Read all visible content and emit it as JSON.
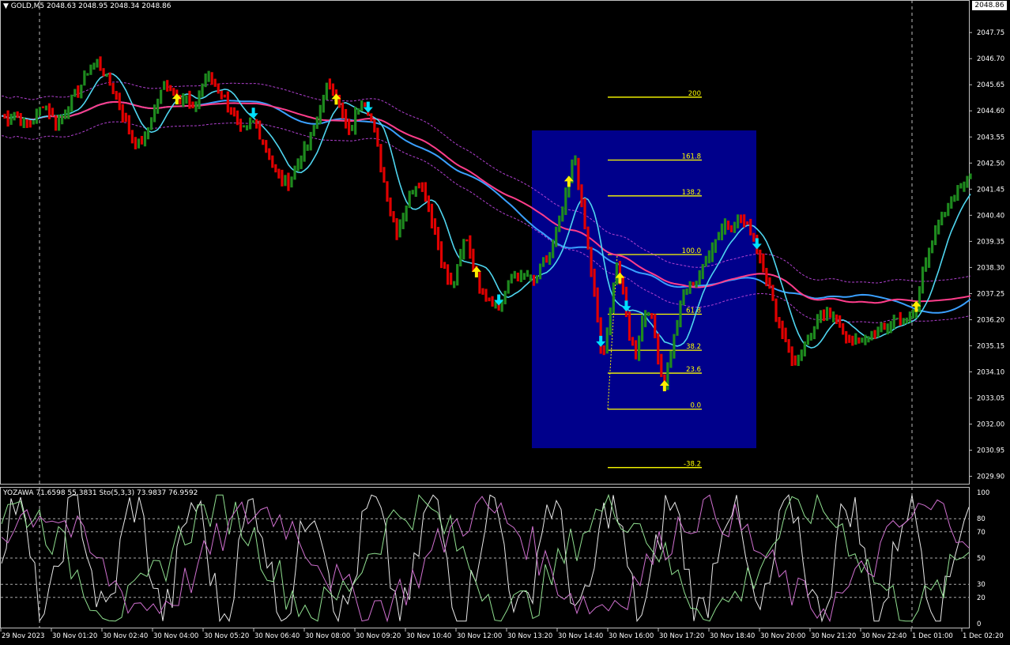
{
  "symbol_header": {
    "symbol": "GOLD,M5",
    "ohlc": "2048.63 2048.95 2048.34 2048.86",
    "current_price": "2048.86"
  },
  "colors": {
    "background": "#000000",
    "bull": "#1e8a1e",
    "bear": "#e00000",
    "fast_ma": "#4fd6f0",
    "slow_ma": "#3aa0ff",
    "long_ma": "#ff3d8b",
    "envelope": "#b040d0",
    "fib_line": "#ffff00",
    "fib_box": "#00008b",
    "up_arrow": "#ffee00",
    "down_arrow": "#00e0ff"
  },
  "price_axis": {
    "ticks": [
      "2047.75",
      "2046.70",
      "2045.65",
      "2044.60",
      "2043.55",
      "2042.50",
      "2041.45",
      "2040.40",
      "2039.35",
      "2038.30",
      "2037.25",
      "2036.20",
      "2035.15",
      "2034.10",
      "2033.05",
      "2032.00",
      "2030.95",
      "2029.90"
    ]
  },
  "fibonacci": {
    "levels": [
      {
        "label": "200",
        "price": 2045.15
      },
      {
        "label": "161.8",
        "price": 2042.62
      },
      {
        "label": "138.2",
        "price": 2041.18
      },
      {
        "label": "100.0",
        "price": 2038.82
      },
      {
        "label": "61.8",
        "price": 2036.42
      },
      {
        "label": "38.2",
        "price": 2034.97
      },
      {
        "label": "23.6",
        "price": 2034.05
      },
      {
        "label": "0.0",
        "price": 2032.6
      },
      {
        "label": "-38.2",
        "price": 2030.25
      }
    ]
  },
  "oscillator": {
    "header": "YOZAWA 71.6598 55.3831  Sto(5,3,3) 73.9837 76.9592",
    "levels": [
      "100",
      "80",
      "70",
      "50",
      "30",
      "20",
      "0"
    ]
  },
  "time_axis": {
    "labels": [
      "29 Nov 2023",
      "30 Nov 01:20",
      "30 Nov 02:40",
      "30 Nov 04:00",
      "30 Nov 05:20",
      "30 Nov 06:40",
      "30 Nov 08:00",
      "30 Nov 09:20",
      "30 Nov 10:40",
      "30 Nov 12:00",
      "30 Nov 13:20",
      "30 Nov 14:40",
      "30 Nov 16:00",
      "30 Nov 17:20",
      "30 Nov 18:40",
      "30 Nov 20:00",
      "30 Nov 21:20",
      "30 Nov 22:40",
      "1 Dec 01:00",
      "1 Dec 02:20"
    ]
  },
  "chart_data": {
    "type": "line",
    "title": "",
    "price_series_close": [
      2044.4,
      2044.3,
      2044.6,
      2044.1,
      2044.0,
      2044.4,
      2044.9,
      2044.6,
      2044.1,
      2044.3,
      2045.0,
      2045.3,
      2045.8,
      2046.4,
      2046.5,
      2046.1,
      2045.6,
      2045.0,
      2044.3,
      2043.6,
      2043.2,
      2043.5,
      2044.3,
      2045.1,
      2045.8,
      2045.4,
      2045.1,
      2045.2,
      2044.6,
      2045.3,
      2046.0,
      2045.7,
      2045.4,
      2044.9,
      2044.4,
      2043.8,
      2043.9,
      2044.2,
      2043.5,
      2043.0,
      2042.1,
      2041.9,
      2041.7,
      2042.3,
      2042.8,
      2043.3,
      2044.1,
      2045.0,
      2045.8,
      2045.2,
      2044.4,
      2043.6,
      2044.6,
      2045.2,
      2044.4,
      2043.3,
      2041.8,
      2040.5,
      2039.7,
      2040.6,
      2041.3,
      2041.8,
      2041.3,
      2040.3,
      2039.2,
      2038.1,
      2037.5,
      2038.4,
      2039.7,
      2038.5,
      2037.6,
      2037.2,
      2036.9,
      2036.7,
      2037.4,
      2038.2,
      2037.8,
      2038.0,
      2037.7,
      2038.3,
      2038.6,
      2039.4,
      2040.3,
      2041.5,
      2042.8,
      2040.8,
      2038.9,
      2037.0,
      2034.6,
      2036.0,
      2038.6,
      2037.4,
      2035.6,
      2034.8,
      2036.3,
      2036.7,
      2035.2,
      2033.4,
      2034.8,
      2036.1,
      2037.3,
      2037.6,
      2037.8,
      2038.4,
      2039.1,
      2039.6,
      2040.1,
      2039.9,
      2040.3,
      2040.1,
      2039.7,
      2038.8,
      2038.0,
      2036.9,
      2036.0,
      2035.4,
      2034.3,
      2034.8,
      2035.2,
      2035.7,
      2036.4,
      2036.6,
      2036.3,
      2035.8,
      2035.4,
      2035.3,
      2035.2,
      2035.6,
      2035.8,
      2035.7,
      2036.0,
      2036.3,
      2036.1,
      2036.2,
      2036.6,
      2038.2,
      2039.1,
      2039.8,
      2040.4,
      2040.9,
      2041.3,
      2041.8,
      2042.2
    ],
    "ylim": [
      2029.6,
      2048.9
    ],
    "oscillator_ylim": [
      0,
      100
    ]
  }
}
